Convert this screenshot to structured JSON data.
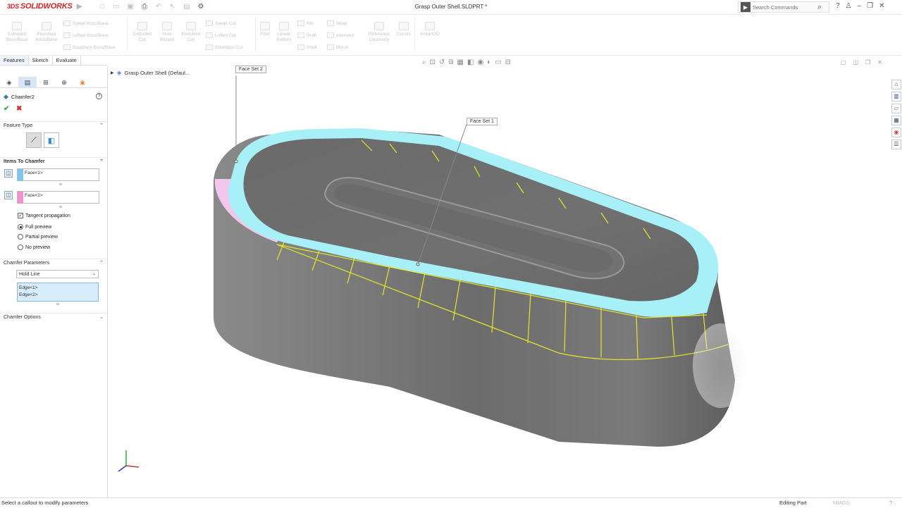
{
  "app": {
    "logo_text": "SOLIDWORKS",
    "logo_prefix": "3DS",
    "doc_title": "Grasp Outer Shell.SLDPRT *",
    "search_placeholder": "Search Commands"
  },
  "ribbon": {
    "large_buttons": [
      "Extruded Boss/Base",
      "Revolved Boss/Base",
      "Extruded Cut",
      "Hole Wizard",
      "Revolved Cut",
      "Fillet",
      "Linear Pattern",
      "Reference Geometry",
      "Curves",
      "Instant3D"
    ],
    "small_buttons": [
      "Swept Boss/Base",
      "Lofted Boss/Base",
      "Boundary Boss/Base",
      "Swept Cut",
      "Lofted Cut",
      "Boundary Cut",
      "Rib",
      "Draft",
      "Shell",
      "Wrap",
      "Intersect",
      "Mirror"
    ]
  },
  "tabs": [
    "Features",
    "Sketch",
    "Evaluate"
  ],
  "panel": {
    "feature_name": "Chamfer2",
    "sections": {
      "feature_type": "Feature Type",
      "items": "Items To Chamfer",
      "params": "Chamfer Parameters",
      "options": "Chamfer Options"
    },
    "face1": "Face<1>",
    "face2": "Face<2>",
    "tangent": "Tangent propagation",
    "preview": [
      "Full preview",
      "Partial preview",
      "No preview"
    ],
    "hold_line": "Hold Line",
    "edges": [
      "Edge<1>",
      "Edge<2>"
    ]
  },
  "viewport": {
    "tree_node": "Grasp Outer Shell  (Defaul...",
    "callout1": "Face Set 2",
    "callout2": "Face Set 1"
  },
  "status": {
    "message": "Select a callout to modify parameters",
    "mode": "Editing Part",
    "units": "MMGS"
  },
  "colors": {
    "accent": "#d0232a",
    "face1": "#7cc4f2",
    "face2": "#f48fd1",
    "chamfer_highlight": "#a8f0f8",
    "edge_lines": "#e6e62a",
    "body": "#7a7a7a"
  },
  "icons": [
    "3ds-logo",
    "new-icon",
    "open-icon",
    "save-icon",
    "print-icon",
    "undo-icon",
    "select-icon",
    "rebuild-icon",
    "options-icon",
    "search-icon",
    "help-icon",
    "minimize-icon",
    "maximize-icon",
    "close-icon"
  ]
}
